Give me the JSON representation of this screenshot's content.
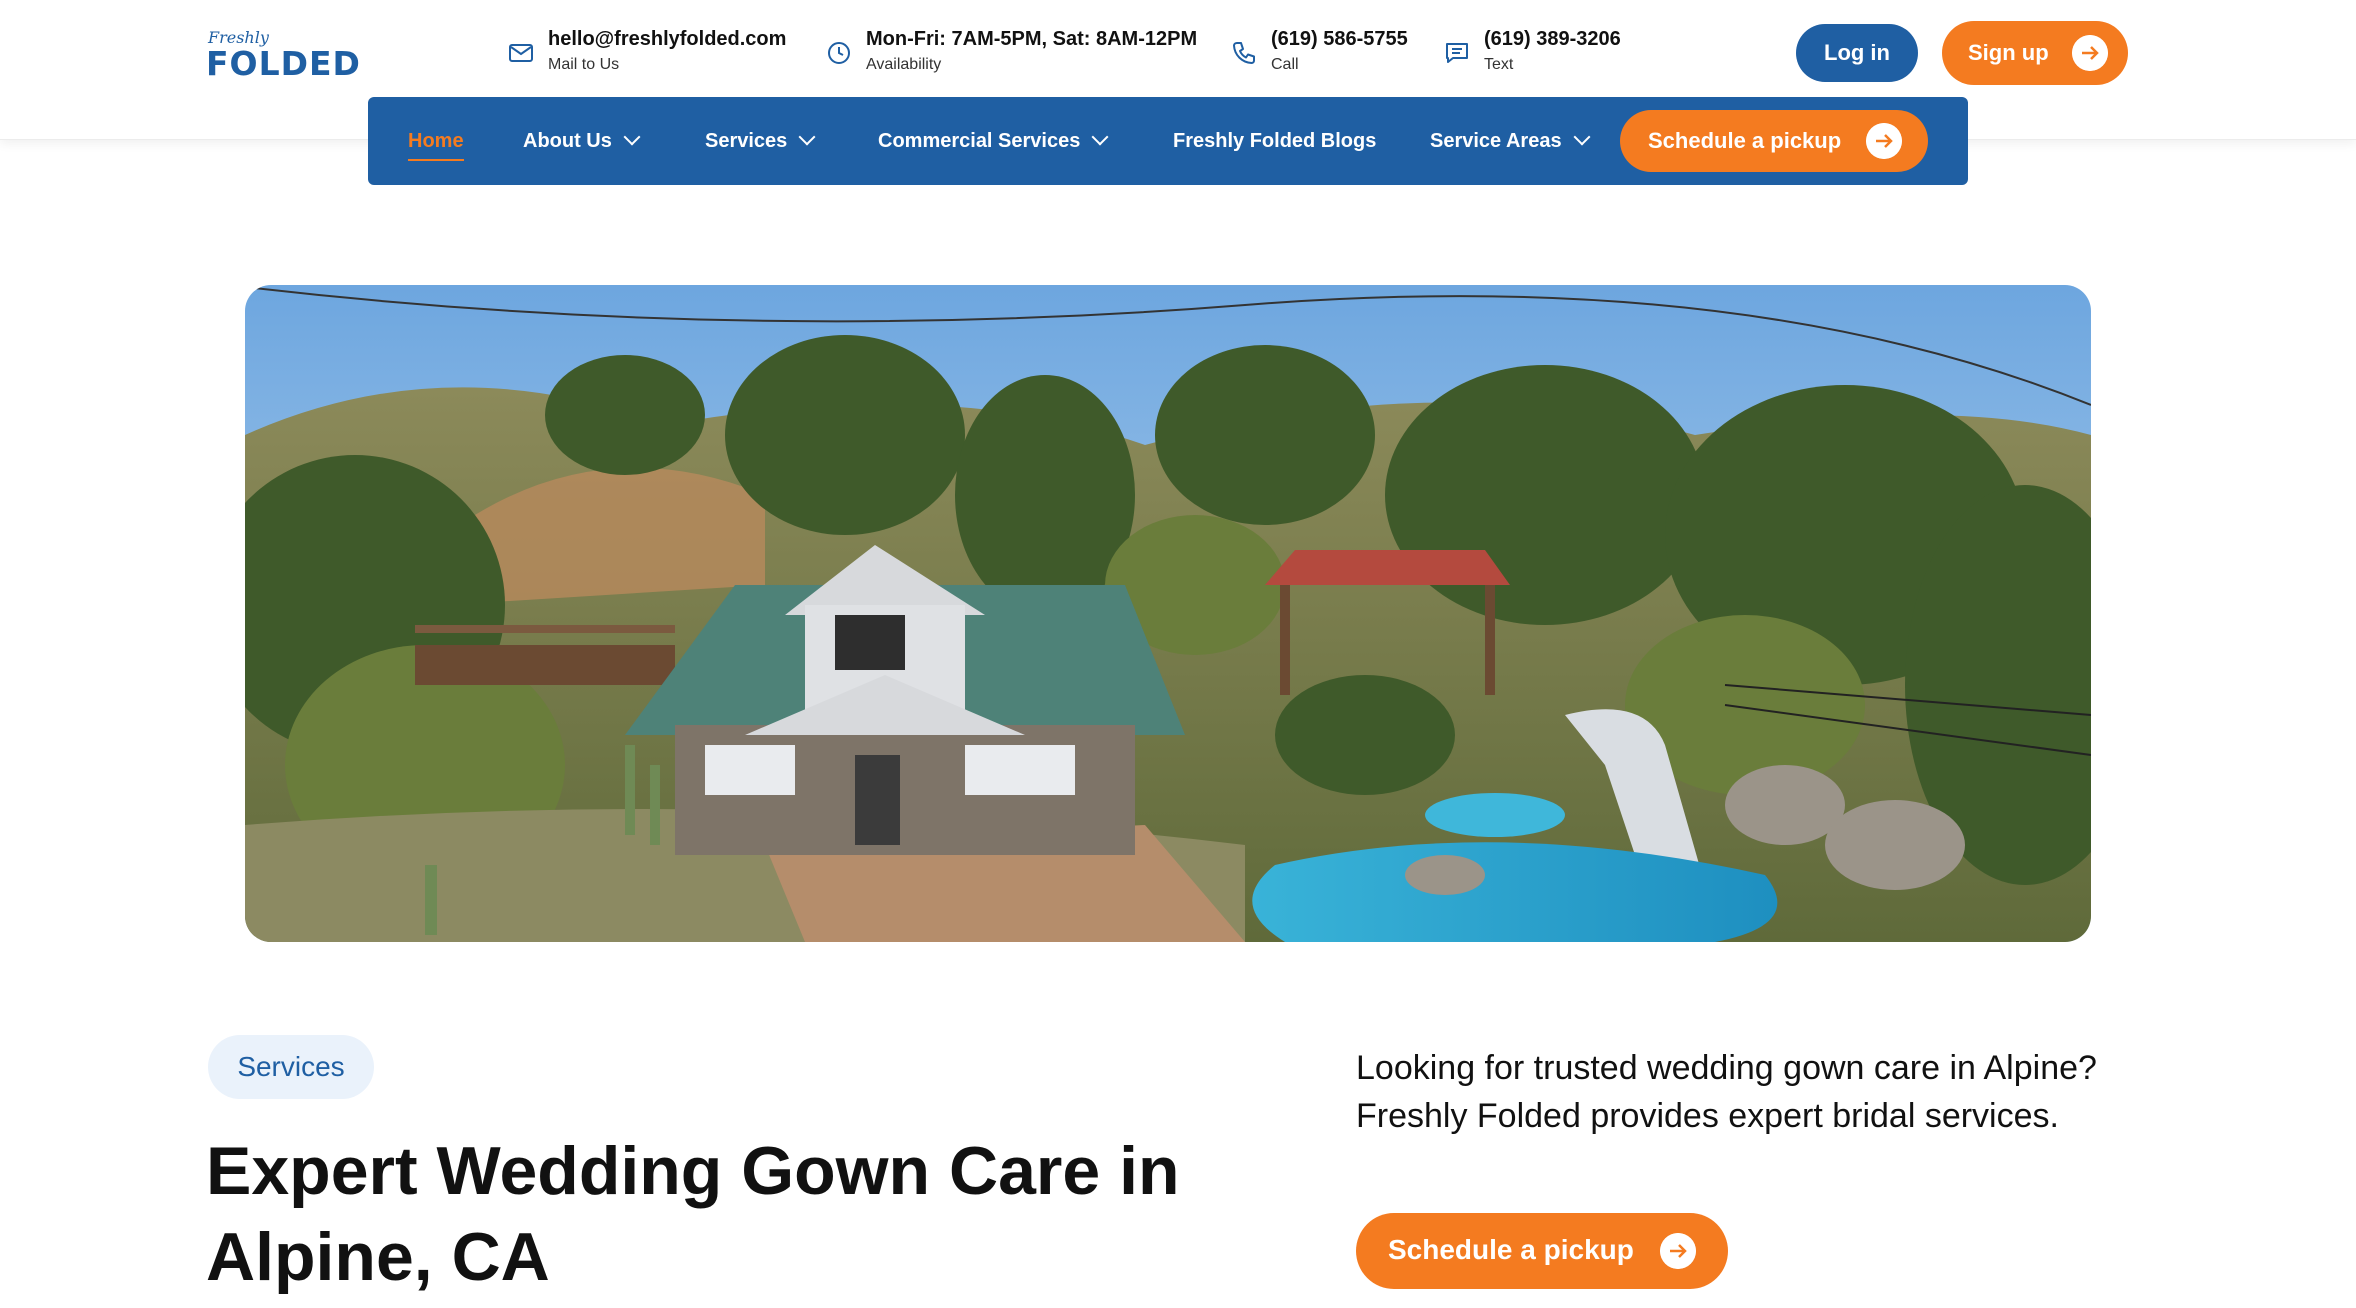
{
  "brand": {
    "logo_small": "Freshly",
    "logo_big": "FOLDED",
    "color_blue": "#1f5fa3",
    "color_orange": "#f47b20"
  },
  "contacts": [
    {
      "icon": "mail-icon",
      "main": "hello@freshlyfolded.com",
      "sub": "Mail to Us"
    },
    {
      "icon": "clock-icon",
      "main": "Mon-Fri: 7AM-5PM, Sat: 8AM-12PM",
      "sub": "Availability"
    },
    {
      "icon": "phone-icon",
      "main": "(619) 586-5755",
      "sub": "Call"
    },
    {
      "icon": "message-icon",
      "main": "(619) 389-3206",
      "sub": "Text"
    }
  ],
  "auth": {
    "login_label": "Log in",
    "signup_label": "Sign up"
  },
  "nav": {
    "items": [
      {
        "label": "Home",
        "active": true
      },
      {
        "label": "About Us",
        "dropdown": true
      },
      {
        "label": "Services",
        "dropdown": true
      },
      {
        "label": "Commercial Services",
        "dropdown": true
      },
      {
        "label": "Freshly Folded Blogs"
      },
      {
        "label": "Service Areas",
        "dropdown": true
      }
    ],
    "cta_label": "Schedule a pickup"
  },
  "hero": {
    "image_subject": "house-with-pool-photo"
  },
  "content": {
    "pill_label": "Services",
    "headline": "Expert Wedding Gown Care in Alpine, CA",
    "description": "Looking for trusted wedding gown care in Alpine? Freshly Folded provides expert bridal services.",
    "cta_label": "Schedule a pickup"
  }
}
